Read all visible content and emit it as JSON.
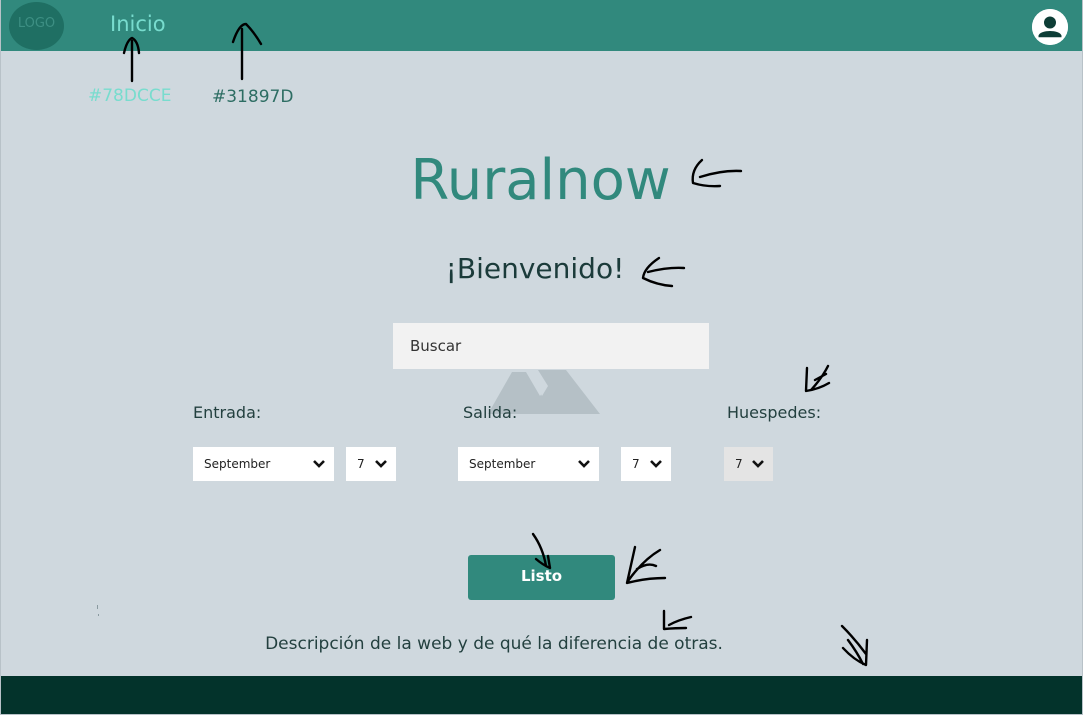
{
  "header": {
    "logo_text": "LOGO",
    "nav_inicio": "Inicio",
    "user_icon": "user-account-icon"
  },
  "annotations": {
    "color_nav_text": "#78DCCE",
    "color_header_bg": "#31897D"
  },
  "main": {
    "brand": "Ruralnow",
    "welcome": "¡Bienvenido!",
    "search_placeholder": "Buscar",
    "entrada": {
      "label": "Entrada:",
      "month": "September",
      "day": "7"
    },
    "salida": {
      "label": "Salida:",
      "month": "September",
      "day": "7"
    },
    "huespedes": {
      "label": "Huespedes:",
      "value": "7"
    },
    "submit_label": "Listo",
    "description": "Descripción de la web y de qué la diferencia de otras."
  },
  "colors": {
    "header_bg": "#31897d",
    "nav_text": "#78dcce",
    "page_bg": "#cfd8de",
    "footer_bg": "#03332b",
    "button_bg": "#31897d"
  }
}
